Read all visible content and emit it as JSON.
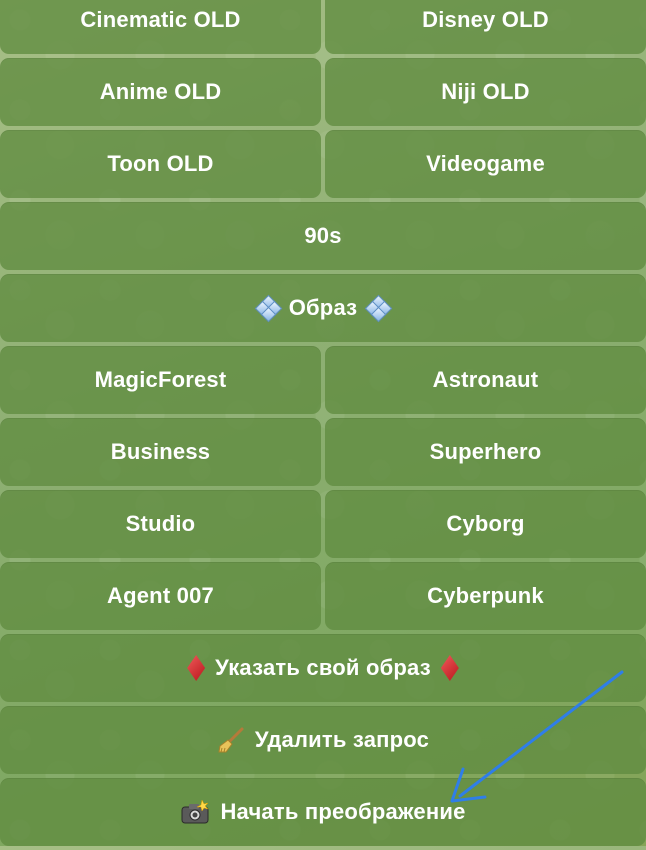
{
  "keyboard": {
    "rows": [
      [
        "Cinematic OLD",
        "Disney OLD"
      ],
      [
        "Anime OLD",
        "Niji OLD"
      ],
      [
        "Toon OLD",
        "Videogame"
      ],
      [
        "90s"
      ],
      [
        "Образ"
      ],
      [
        "MagicForest",
        "Astronaut"
      ],
      [
        "Business",
        "Superhero"
      ],
      [
        "Studio",
        "Cyborg"
      ],
      [
        "Agent 007",
        "Cyberpunk"
      ],
      [
        "Указать свой образ"
      ],
      [
        "Удалить запрос"
      ],
      [
        "Начать преображение"
      ]
    ],
    "icons": {
      "obraz": "blue-diamond-cluster-icon",
      "custom": "red-diamond-icon",
      "delete": "broom-icon",
      "start": "camera-flash-icon"
    }
  },
  "colors": {
    "button_bg": "#6a9446",
    "text": "#ffffff",
    "annotation_arrow": "#2f7ee8"
  }
}
